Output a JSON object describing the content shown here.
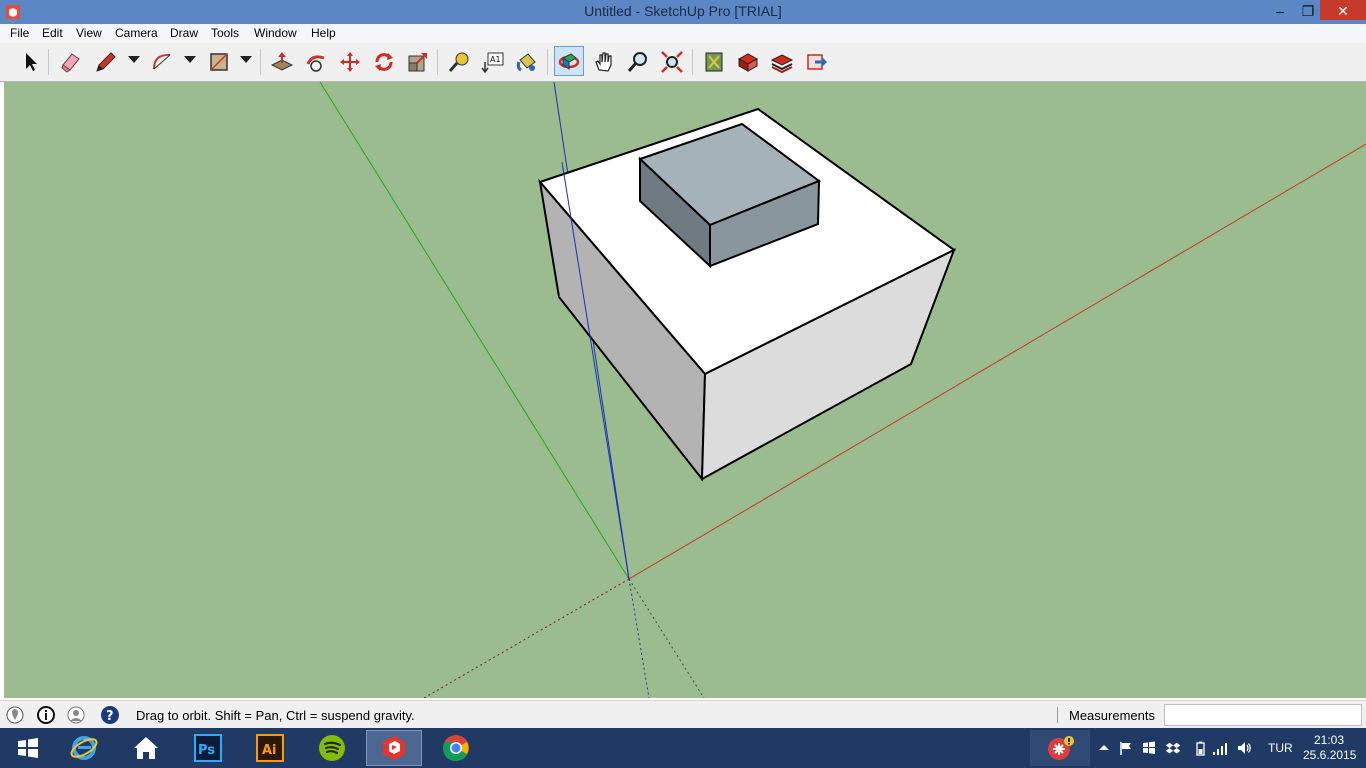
{
  "window": {
    "title": "Untitled - SketchUp Pro [TRIAL]",
    "minimize_glyph": "–",
    "maximize_glyph": "❐",
    "close_glyph": "✕"
  },
  "menu": [
    "File",
    "Edit",
    "View",
    "Camera",
    "Draw",
    "Tools",
    "Window",
    "Help"
  ],
  "toolbar": {
    "active_tool": "orbit",
    "tools": [
      "select-icon",
      "eraser-icon",
      "pencil-line-icon",
      "arc-icon",
      "rectangle-icon",
      "push-pull-icon",
      "follow-me-icon",
      "move-icon",
      "rotate-icon",
      "scale-icon",
      "tape-measure-icon",
      "text-icon",
      "paint-bucket-icon",
      "orbit-icon",
      "pan-icon",
      "zoom-icon",
      "zoom-extents-icon",
      "warehouse-icon",
      "extension-warehouse-icon",
      "send-to-layout-icon",
      "share-model-icon"
    ]
  },
  "viewport": {
    "background_color": "#9bbc8e",
    "axis_colors": {
      "red": "#c0392b",
      "green": "#1fa91f",
      "blue": "#1c2fb8"
    }
  },
  "status": {
    "hint": "Drag to orbit. Shift = Pan, Ctrl = suspend gravity.",
    "measurements_label": "Measurements",
    "measurements_value": ""
  },
  "taskbar": {
    "apps": [
      "windows-start-icon",
      "internet-explorer-icon",
      "file-explorer-home-icon",
      "photoshop-icon",
      "illustrator-icon",
      "spotify-icon",
      "sketchup-icon",
      "chrome-icon"
    ],
    "photoshop_label": "Ps",
    "illustrator_label": "Ai",
    "language": "TUR",
    "time": "21:03",
    "date": "25.6.2015"
  }
}
